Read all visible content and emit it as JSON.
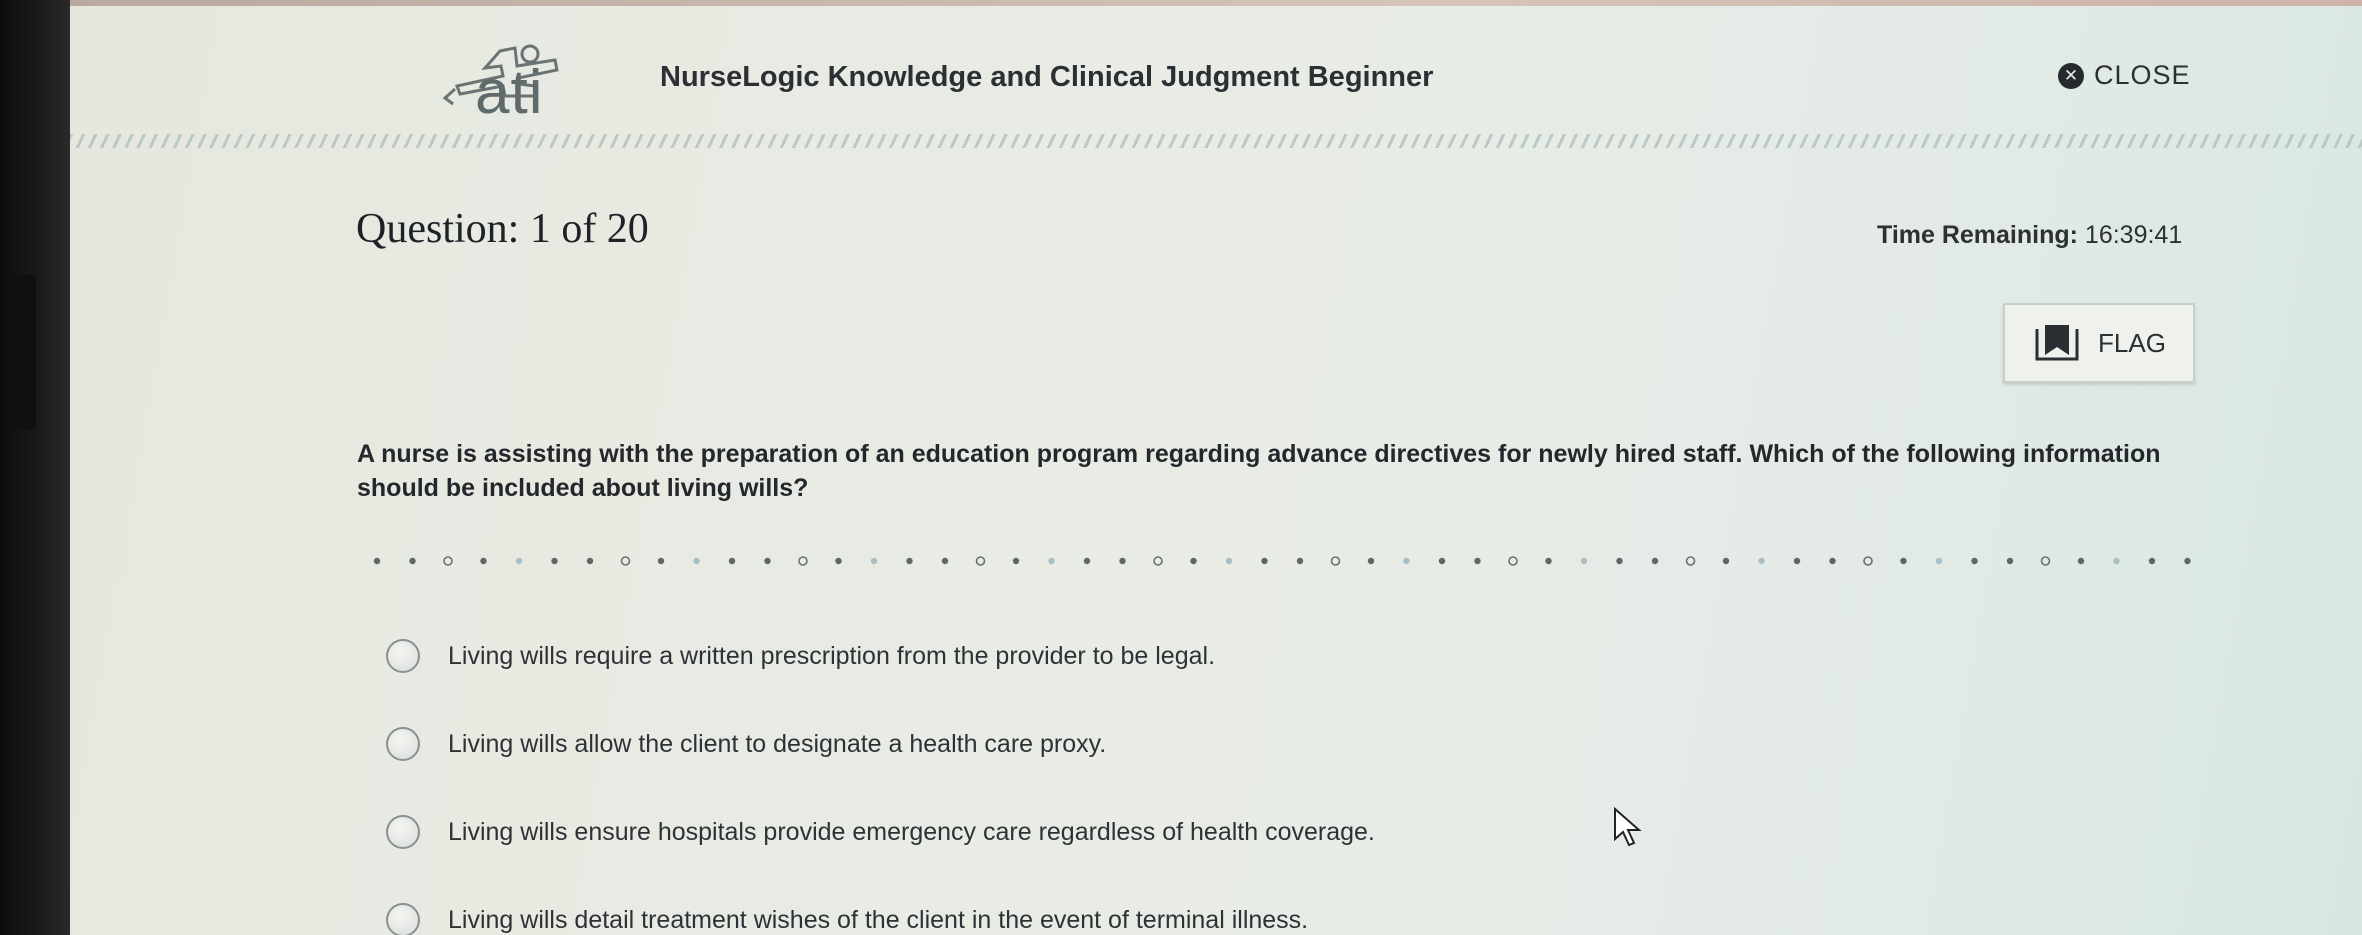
{
  "header": {
    "logo_text": "ati",
    "title": "NurseLogic Knowledge and Clinical Judgment Beginner",
    "close_label": "CLOSE"
  },
  "question": {
    "number_label": "Question: 1 of 20",
    "time_label": "Time Remaining:",
    "time_value": "16:39:41",
    "flag_label": "FLAG",
    "prompt": "A nurse is assisting with the preparation of an education program regarding advance directives for newly hired staff. Which of the following information should be included about living wills?"
  },
  "options": [
    {
      "text": "Living wills require a written prescription from the provider to be legal."
    },
    {
      "text": "Living wills allow the client to designate a health care proxy."
    },
    {
      "text": "Living wills ensure hospitals provide emergency care regardless of health coverage."
    },
    {
      "text": "Living wills detail treatment wishes of the client in the event of terminal illness."
    }
  ],
  "icons": {
    "close": "close-circle-icon",
    "flag": "bookmark-flag-icon",
    "logo": "ati-logo"
  },
  "colors": {
    "text": "#2c2f33",
    "divider": "#b7c5c2",
    "screen": "#e8ebe5"
  }
}
